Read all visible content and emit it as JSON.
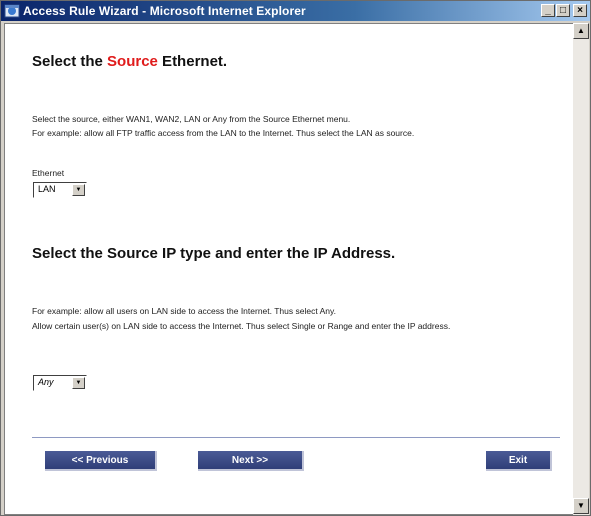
{
  "window": {
    "title": "Access Rule Wizard - Microsoft Internet Explorer",
    "minimize": "_",
    "maximize": "□",
    "close": "×"
  },
  "section1": {
    "heading_pre": "Select the ",
    "heading_highlight": "Source",
    "heading_post": " Ethernet.",
    "desc_line1": "Select the source, either WAN1, WAN2, LAN or Any from the Source Ethernet menu.",
    "desc_line2": "For example: allow all FTP traffic access from the LAN to the Internet. Thus select the LAN as source.",
    "ethernet_label": "Ethernet",
    "ethernet_value": "LAN"
  },
  "section2": {
    "heading": "Select the Source IP type and enter the IP Address.",
    "desc_line1": "For example: allow all users on LAN side to access the Internet. Thus select Any.",
    "desc_line2": "Allow certain user(s) on LAN side to access the Internet. Thus select Single or Range and enter the IP address.",
    "ip_type_value": "Any"
  },
  "buttons": {
    "previous": "<< Previous",
    "next": "Next >>",
    "exit": "Exit"
  },
  "colors": {
    "accent_red": "#e01b1b",
    "button_blue": "#3a4a86",
    "titlebar": "#0a246a"
  }
}
